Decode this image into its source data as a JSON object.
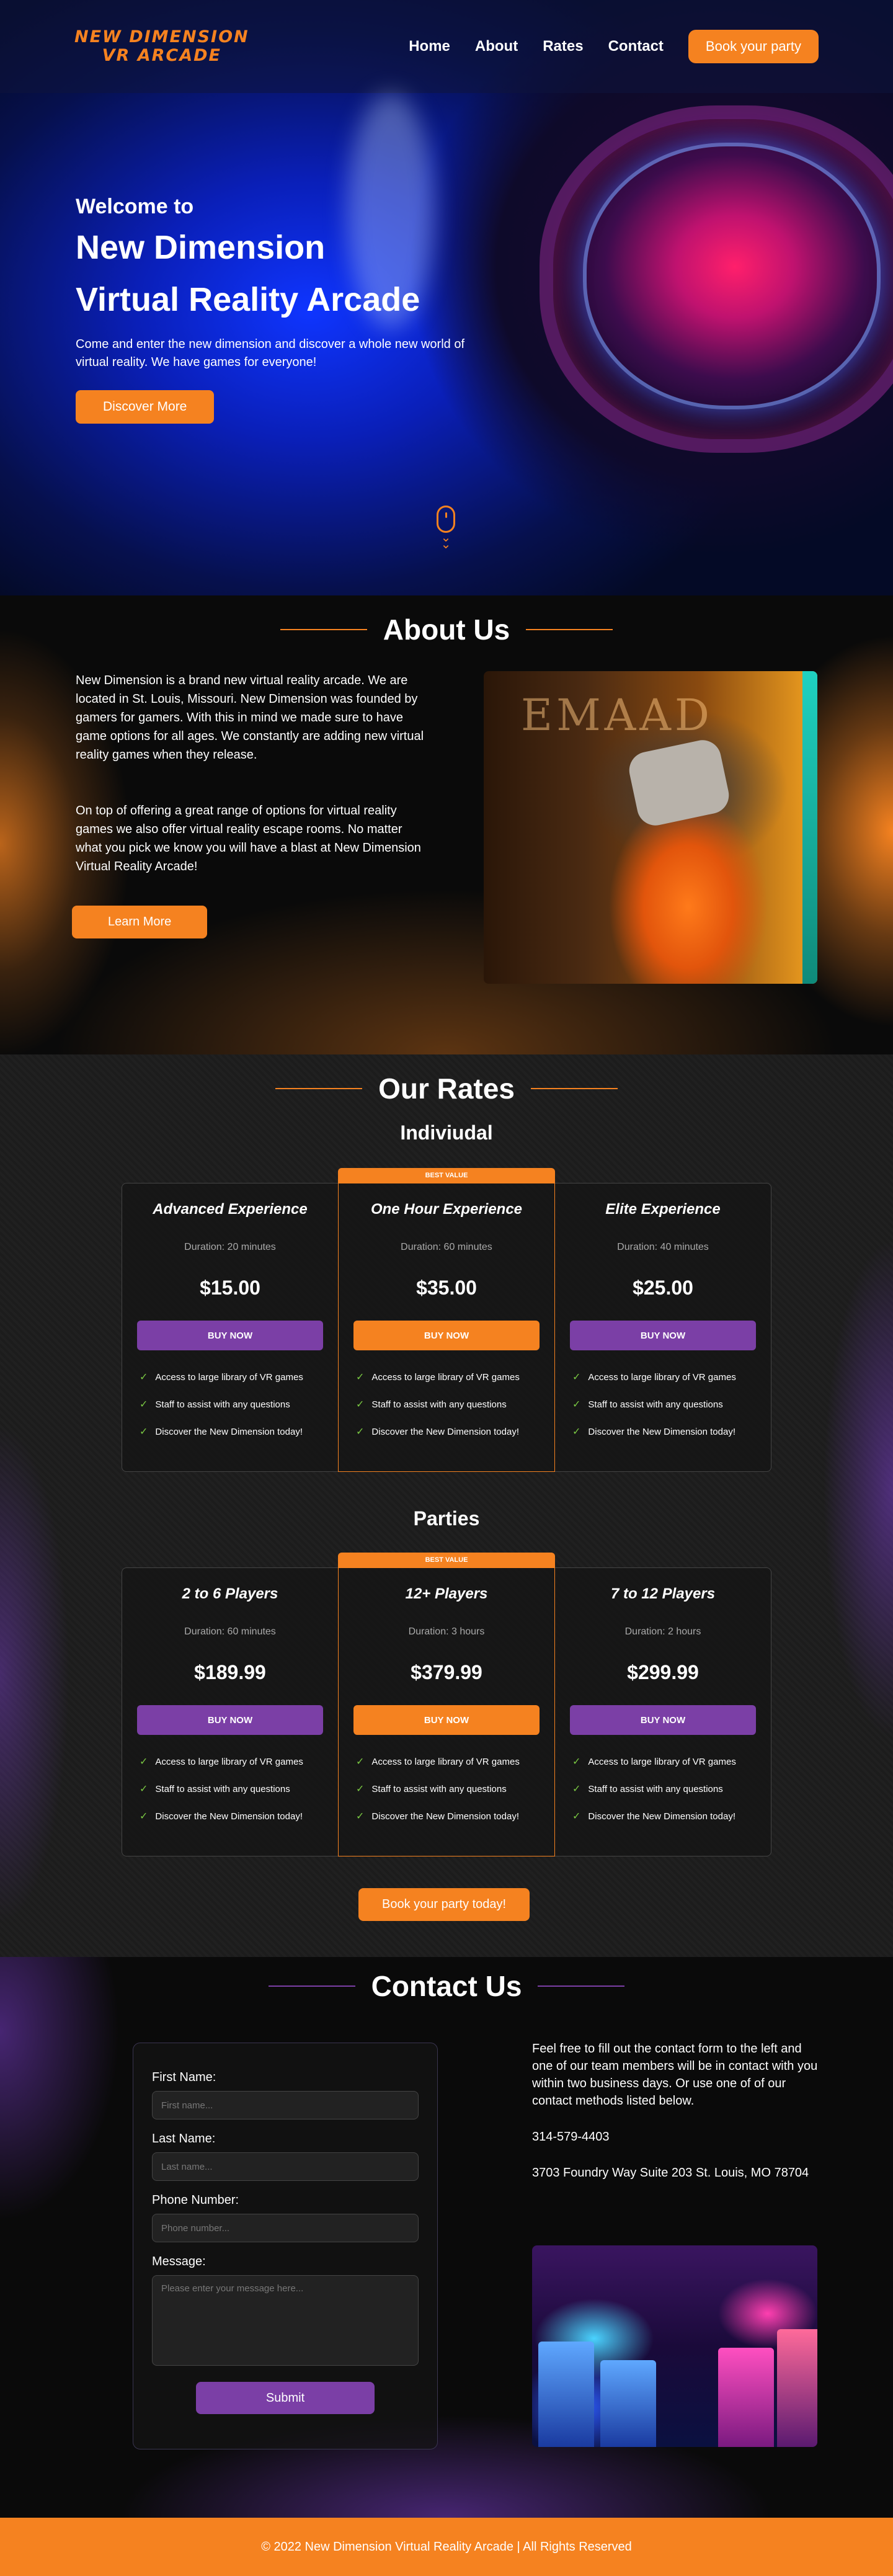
{
  "header": {
    "logo_line1": "NEW DIMENSION",
    "logo_line2": "VR ARCADE",
    "nav": [
      "Home",
      "About",
      "Rates",
      "Contact"
    ],
    "cta": "Book your party"
  },
  "hero": {
    "welcome": "Welcome to",
    "title_line1": "New Dimension",
    "title_line2": "Virtual Reality Arcade",
    "description": "Come and enter the new dimension and discover a whole new world of virtual reality. We have games for everyone!",
    "button": "Discover More"
  },
  "about": {
    "heading": "About Us",
    "paragraph1": "New Dimension is a brand new virtual reality arcade. We are located in St. Louis, Missouri. New Dimension was founded by gamers for gamers. With this in mind we made sure to have game options for all ages. We constantly are adding new virtual reality games when they release.",
    "paragraph2": "On top of offering a great range of options for virtual reality games we also offer virtual reality escape rooms. No matter what you pick we know you will have a blast at New Dimension Virtual Reality Arcade!",
    "button": "Learn More",
    "photo_sign": "EMAAD"
  },
  "rates": {
    "heading": "Our Rates",
    "individual_heading": "Indiviudal",
    "parties_heading": "Parties",
    "badge": "BEST VALUE",
    "buy_label": "BUY NOW",
    "features": [
      "Access to large library of VR games",
      "Staff to assist with any questions",
      "Discover the New Dimension today!"
    ],
    "individual": [
      {
        "name": "Advanced Experience",
        "duration": "Duration: 20 minutes",
        "price": "$15.00"
      },
      {
        "name": "One Hour Experience",
        "duration": "Duration: 60 minutes",
        "price": "$35.00"
      },
      {
        "name": "Elite Experience",
        "duration": "Duration: 40 minutes",
        "price": "$25.00"
      }
    ],
    "parties": [
      {
        "name": "2 to 6 Players",
        "duration": "Duration: 60 minutes",
        "price": "$189.99"
      },
      {
        "name": "12+ Players",
        "duration": "Duration: 3 hours",
        "price": "$379.99"
      },
      {
        "name": "7 to 12 Players",
        "duration": "Duration: 2 hours",
        "price": "$299.99"
      }
    ],
    "party_button": "Book your party today!"
  },
  "contact": {
    "heading": "Contact Us",
    "first_name_label": "First Name:",
    "first_name_placeholder": "First name...",
    "last_name_label": "Last Name:",
    "last_name_placeholder": "Last name...",
    "phone_label": "Phone Number:",
    "phone_placeholder": "Phone number...",
    "message_label": "Message:",
    "message_placeholder": "Please enter your message here...",
    "submit": "Submit",
    "info": "Feel free to fill out the contact form to the left and one of our team members will be in contact with you within two business days.  Or use one of of our contact methods listed below.",
    "phone": "314-579-4403",
    "address": "3703 Foundry Way Suite 203 St. Louis, MO 78704"
  },
  "footer": {
    "text": "© 2022 New Dimension Virtual Reality Arcade | All Rights Reserved"
  },
  "colors": {
    "accent": "#f58220",
    "purple": "#7b3fa6",
    "check": "#7ac943"
  }
}
